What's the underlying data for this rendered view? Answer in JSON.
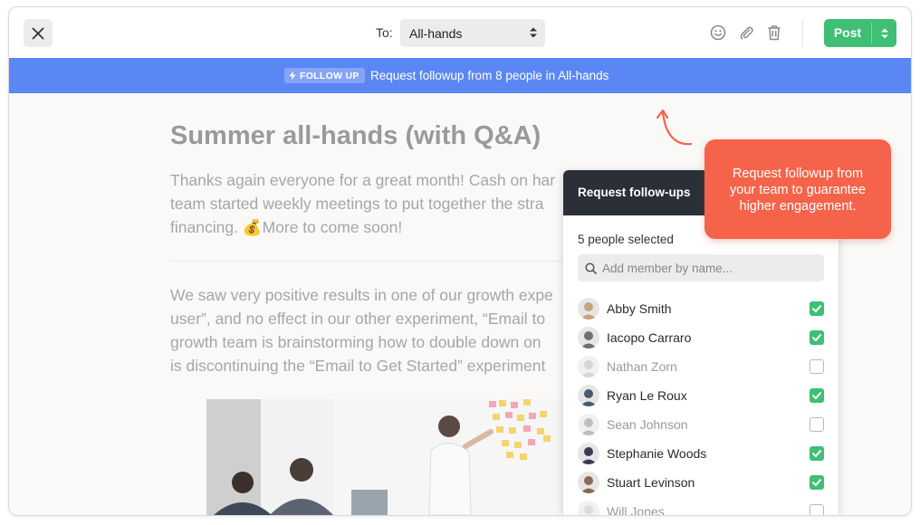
{
  "toolbar": {
    "to_label": "To:",
    "to_value": "All-hands",
    "post_label": "Post",
    "icons": [
      "emoji-icon",
      "attachment-icon",
      "trash-icon",
      "close-icon"
    ]
  },
  "banner": {
    "pill": "FOLLOW UP",
    "text": "Request followup from 8 people in All-hands",
    "color": "#5b87f5"
  },
  "document": {
    "title": "Summer all-hands (with Q&A)",
    "para1": [
      "Thanks again everyone for a great month! Cash on har",
      "team started weekly meetings to put together the stra",
      "financing. 💰More to come soon!"
    ],
    "para2": [
      "We saw very positive results in one of our growth expe",
      "user”, and no effect in our other experiment, “Email to",
      "growth team is brainstorming how to double down on",
      "is discontinuing the “Email to Get Started” experiment"
    ]
  },
  "popover": {
    "title": "Request follow-ups",
    "selected_text": "5 people selected",
    "search_placeholder": "Add member by name...",
    "members": [
      {
        "name": "Abby Smith",
        "checked": true,
        "avatar": "#c9a27e"
      },
      {
        "name": "Iacopo Carraro",
        "checked": true,
        "avatar": "#6f6f6f"
      },
      {
        "name": "Nathan Zorn",
        "checked": false,
        "avatar": "#b5b5b5"
      },
      {
        "name": "Ryan Le Roux",
        "checked": true,
        "avatar": "#4a5a6a"
      },
      {
        "name": "Sean Johnson",
        "checked": false,
        "avatar": "#8a8a8a"
      },
      {
        "name": "Stephanie Woods",
        "checked": true,
        "avatar": "#3d3a52"
      },
      {
        "name": "Stuart Levinson",
        "checked": true,
        "avatar": "#8a6b55"
      },
      {
        "name": "Will Jones",
        "checked": false,
        "avatar": "#c0c0c0"
      }
    ]
  },
  "tooltip": {
    "lines": [
      "Request followup from",
      "your team to guarantee",
      "higher engagement."
    ],
    "color": "#f5634a"
  },
  "colors": {
    "accent_green": "#3fbf73",
    "dark_header": "#2b3038"
  }
}
